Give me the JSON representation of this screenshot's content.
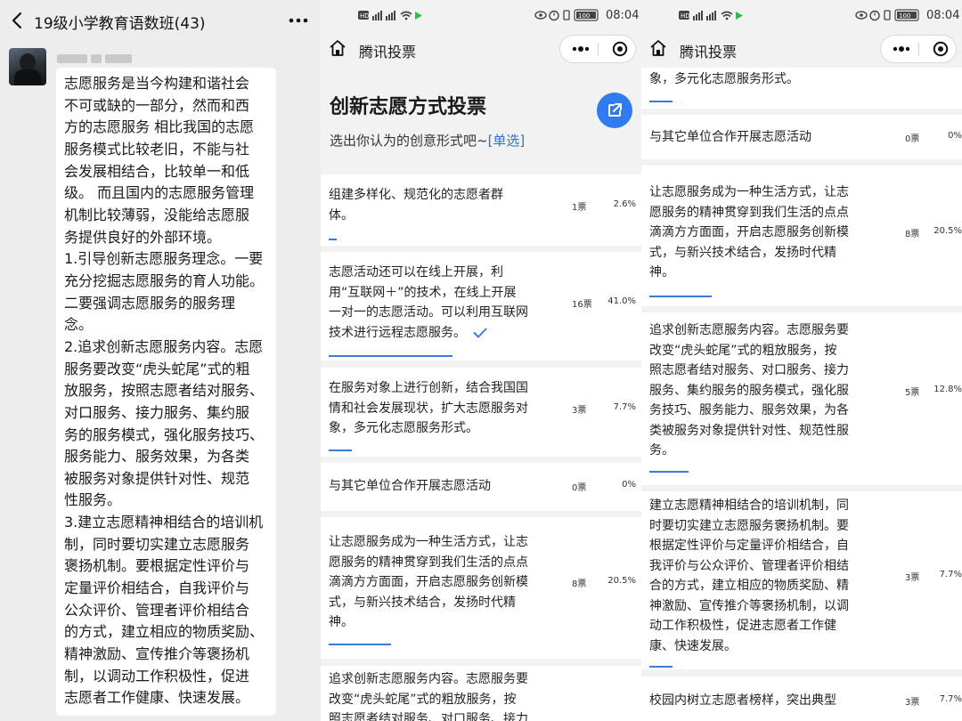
{
  "chat": {
    "title": "19级小学教育语数班(43)",
    "message_lines": [
      "志愿服务是当今构建和谐社会",
      "不可或缺的一部分，然而和西",
      "方的志愿服务 相比我国的志愿",
      "服务模式比较老旧，不能与社",
      "会发展相结合，比较单一和低",
      "级。 而且国内的志愿服务管理",
      "机制比较薄弱，没能给志愿服",
      "务提供良好的外部环境。",
      "1.引导创新志愿服务理念。一要",
      "充分挖掘志愿服务的育人功能。",
      "二要强调志愿服务的服务理",
      "念。",
      "2.追求创新志愿服务内容。志愿",
      "服务要改变“虎头蛇尾”式的粗",
      "放服务，按照志愿者结对服务、",
      "对口服务、接力服务、集约服",
      "务的服务模式，强化服务技巧、",
      "服务能力、服务效果，为各类",
      "被服务对象提供针对性、规范",
      "性服务。",
      "3.建立志愿精神相结合的培训机",
      "制，同时要切实建立志愿服务",
      "褒扬机制。要根据定性评价与",
      "定量评价相结合，自我评价与",
      "公众评价、管理者评价相结合",
      "的方式，建立相应的物质奖励、",
      "精神激励、宣传推介等褒扬机",
      "制，以调动工作积极性，促进",
      "志愿者工作健康、快速发展。"
    ]
  },
  "status_bar": {
    "time": "08:04",
    "battery": "100"
  },
  "mini_program": {
    "title": "腾讯投票"
  },
  "vote": {
    "title": "创新志愿方式投票",
    "subtitle": "选出你认为的创意形式吧~",
    "subtitle_tag": "[单选]",
    "accent": "#2f7bef"
  },
  "panel2_options": [
    {
      "lines": [
        "组建多样化、规范化的志愿者群",
        "体。"
      ],
      "count": "1票",
      "pct": "2.6%",
      "share": 0.026
    },
    {
      "lines": [
        "志愿活动还可以在线上开展，利",
        "用“互联网＋”的技术，在线上开展",
        "一对一的志愿活动。可以利用互联网",
        "技术进行远程志愿服务。"
      ],
      "count": "16票",
      "pct": "41.0%",
      "share": 0.41,
      "selected": true
    },
    {
      "lines": [
        "在服务对象上进行创新，结合我国国",
        "情和社会发展现状，扩大志愿服务对",
        "象，多元化志愿服务形式。"
      ],
      "count": "3票",
      "pct": "7.7%",
      "share": 0.077
    },
    {
      "lines": [
        "与其它单位合作开展志愿活动"
      ],
      "count": "0票",
      "pct": "0%",
      "share": 0
    },
    {
      "lines": [
        "让志愿服务成为一种生活方式，让志",
        "愿服务的精神贯穿到我们生活的点点",
        "滴滴方方面面，开启志愿服务创新模",
        "式，与新兴技术结合，发扬时代精",
        "神。"
      ],
      "count": "8票",
      "pct": "20.5%",
      "share": 0.205
    },
    {
      "lines": [
        "追求创新志愿服务内容。志愿服务要",
        "改变“虎头蛇尾”式的粗放服务，按",
        "照志愿者结对服务、对口服务、接力"
      ],
      "count": "",
      "pct": "",
      "share": 0
    }
  ],
  "panel3_options": [
    {
      "lines": [
        "象，多元化志愿服务形式。"
      ],
      "count": "",
      "pct": "",
      "share": 0.077
    },
    {
      "lines": [
        "与其它单位合作开展志愿活动"
      ],
      "count": "0票",
      "pct": "0%",
      "share": 0
    },
    {
      "lines": [
        "让志愿服务成为一种生活方式，让志",
        "愿服务的精神贯穿到我们生活的点点",
        "滴滴方方面面，开启志愿服务创新模",
        "式，与新兴技术结合，发扬时代精",
        "神。"
      ],
      "count": "8票",
      "pct": "20.5%",
      "share": 0.205
    },
    {
      "lines": [
        "追求创新志愿服务内容。志愿服务要",
        "改变“虎头蛇尾”式的粗放服务，按",
        "照志愿者结对服务、对口服务、接力",
        "服务、集约服务的服务模式，强化服",
        "务技巧、服务能力、服务效果，为各",
        "类被服务对象提供针对性、规范性服",
        "务。"
      ],
      "count": "5票",
      "pct": "12.8%",
      "share": 0.128
    },
    {
      "lines": [
        "建立志愿精神相结合的培训机制，同",
        "时要切实建立志愿服务褒扬机制。要",
        "根据定性评价与定量评价相结合，自",
        "我评价与公众评价、管理者评价相结",
        "合的方式，建立相应的物质奖励、精",
        "神激励、宣传推介等褒扬机制，以调",
        "动工作积极性，促进志愿者工作健",
        "康、快速发展。"
      ],
      "count": "3票",
      "pct": "7.7%",
      "share": 0.077
    },
    {
      "lines": [
        "校园内树立志愿者榜样，突出典型"
      ],
      "count": "3票",
      "pct": "7.7%",
      "share": 0.077
    }
  ]
}
